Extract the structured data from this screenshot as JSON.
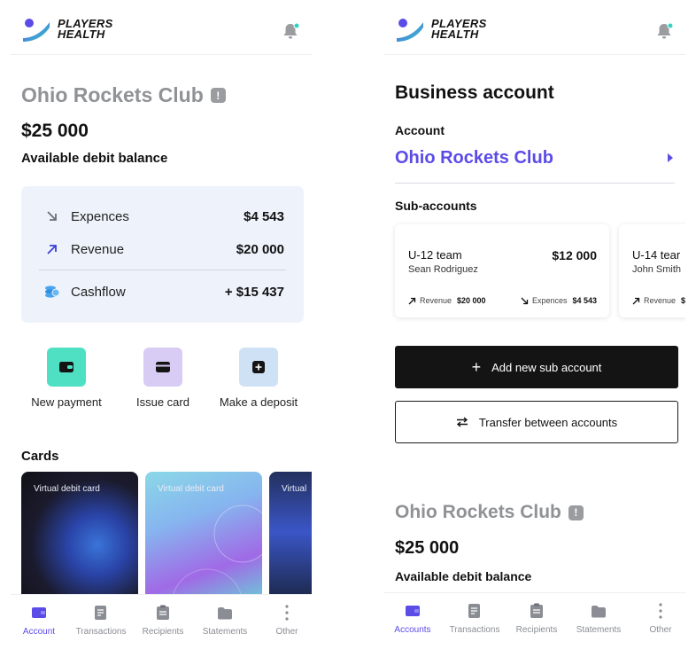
{
  "brand": {
    "line1": "PLAYERS",
    "line2": "HEALTH",
    "accent": "#5b4ce8"
  },
  "left": {
    "club_name": "Ohio Rockets Club",
    "info_badge": "!",
    "balance": "$25 000",
    "balance_label": "Available debit balance",
    "summary": {
      "expences": {
        "label": "Expences",
        "value": "$4 543",
        "icon": "arrow-down-right-icon"
      },
      "revenue": {
        "label": "Revenue",
        "value": "$20 000",
        "icon": "arrow-up-right-icon"
      },
      "cashflow": {
        "label": "Cashflow",
        "value": "+ $15 437",
        "icon": "coins-icon"
      }
    },
    "actions": [
      {
        "label": "New payment",
        "icon": "wallet-icon",
        "color": "#4fe0c4"
      },
      {
        "label": "Issue card",
        "icon": "card-icon",
        "color": "#d8ccf5"
      },
      {
        "label": "Make a deposit",
        "icon": "plus-square-icon",
        "color": "#cfe2f5"
      }
    ],
    "cards_title": "Cards",
    "cards": [
      {
        "label": "Virtual debit card"
      },
      {
        "label": "Virtual debit card"
      },
      {
        "label": "Virtual"
      }
    ],
    "nav": [
      {
        "label": "Account",
        "icon": "wallet-icon",
        "active": true
      },
      {
        "label": "Transactions",
        "icon": "document-icon",
        "active": false
      },
      {
        "label": "Recipients",
        "icon": "clipboard-icon",
        "active": false
      },
      {
        "label": "Statements",
        "icon": "folder-icon",
        "active": false
      },
      {
        "label": "Other",
        "icon": "more-icon",
        "active": false
      }
    ]
  },
  "right": {
    "title": "Business account",
    "account_label": "Account",
    "account_name": "Ohio Rockets Club",
    "sub_accounts_label": "Sub-accounts",
    "sub_accounts": [
      {
        "team": "U-12 team",
        "owner": "Sean Rodriguez",
        "amount": "$12 000",
        "revenue_label": "Revenue",
        "revenue": "$20 000",
        "expences_label": "Expences",
        "expences": "$4 543"
      },
      {
        "team": "U-14 tear",
        "owner": "John Smith",
        "revenue_label": "Revenue",
        "revenue": "$"
      }
    ],
    "add_button": "Add new sub account",
    "transfer_button": "Transfer between accounts",
    "club_name": "Ohio Rockets Club",
    "info_badge": "!",
    "balance": "$25 000",
    "balance_label": "Available debit balance",
    "nav": [
      {
        "label": "Accounts",
        "active": true
      },
      {
        "label": "Transactions",
        "active": false
      },
      {
        "label": "Recipients",
        "active": false
      },
      {
        "label": "Statements",
        "active": false
      },
      {
        "label": "Other",
        "active": false
      }
    ]
  }
}
